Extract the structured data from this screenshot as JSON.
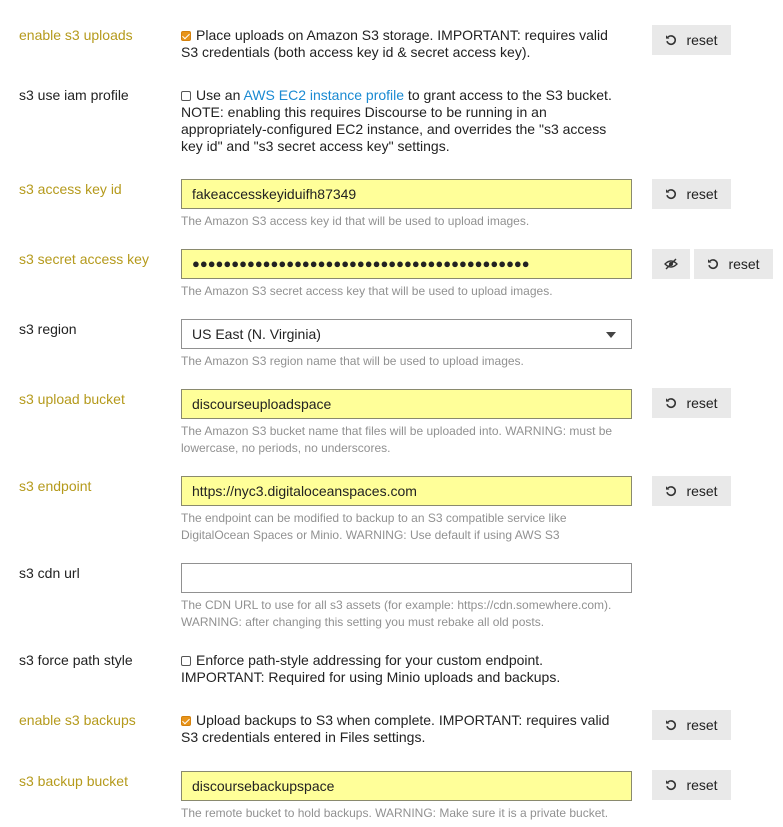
{
  "reset_label": "reset",
  "settings": {
    "enable_s3_uploads": {
      "label": "enable s3 uploads",
      "text": "Place uploads on Amazon S3 storage. IMPORTANT: requires valid S3 credentials (both access key id & secret access key).",
      "checked": true
    },
    "s3_use_iam_profile": {
      "label": "s3 use iam profile",
      "text_before": "Use an ",
      "link_text": "AWS EC2 instance profile",
      "text_after": " to grant access to the S3 bucket. NOTE: enabling this requires Discourse to be running in an appropriately-configured EC2 instance, and overrides the \"s3 access key id\" and \"s3 secret access key\" settings.",
      "checked": false
    },
    "s3_access_key_id": {
      "label": "s3 access key id",
      "value": "fakeaccesskeyiduifh87349",
      "description": "The Amazon S3 access key id that will be used to upload images."
    },
    "s3_secret_access_key": {
      "label": "s3 secret access key",
      "value": "●●●●●●●●●●●●●●●●●●●●●●●●●●●●●●●●●●●●●●●●●●●",
      "description": "The Amazon S3 secret access key that will be used to upload images."
    },
    "s3_region": {
      "label": "s3 region",
      "value": "US East (N. Virginia)",
      "description": "The Amazon S3 region name that will be used to upload images."
    },
    "s3_upload_bucket": {
      "label": "s3 upload bucket",
      "value": "discourseuploadspace",
      "description": "The Amazon S3 bucket name that files will be uploaded into. WARNING: must be lowercase, no periods, no underscores."
    },
    "s3_endpoint": {
      "label": "s3 endpoint",
      "value": "https://nyc3.digitaloceanspaces.com",
      "description": "The endpoint can be modified to backup to an S3 compatible service like DigitalOcean Spaces or Minio. WARNING: Use default if using AWS S3"
    },
    "s3_cdn_url": {
      "label": "s3 cdn url",
      "value": "",
      "description": "The CDN URL to use for all s3 assets (for example: https://cdn.somewhere.com). WARNING: after changing this setting you must rebake all old posts."
    },
    "s3_force_path_style": {
      "label": "s3 force path style",
      "text": "Enforce path-style addressing for your custom endpoint. IMPORTANT: Required for using Minio uploads and backups.",
      "checked": false
    },
    "enable_s3_backups": {
      "label": "enable s3 backups",
      "text": "Upload backups to S3 when complete. IMPORTANT: requires valid S3 credentials entered in Files settings.",
      "checked": true
    },
    "s3_backup_bucket": {
      "label": "s3 backup bucket",
      "value": "discoursebackupspace",
      "description": "The remote bucket to hold backups. WARNING: Make sure it is a private bucket."
    }
  }
}
